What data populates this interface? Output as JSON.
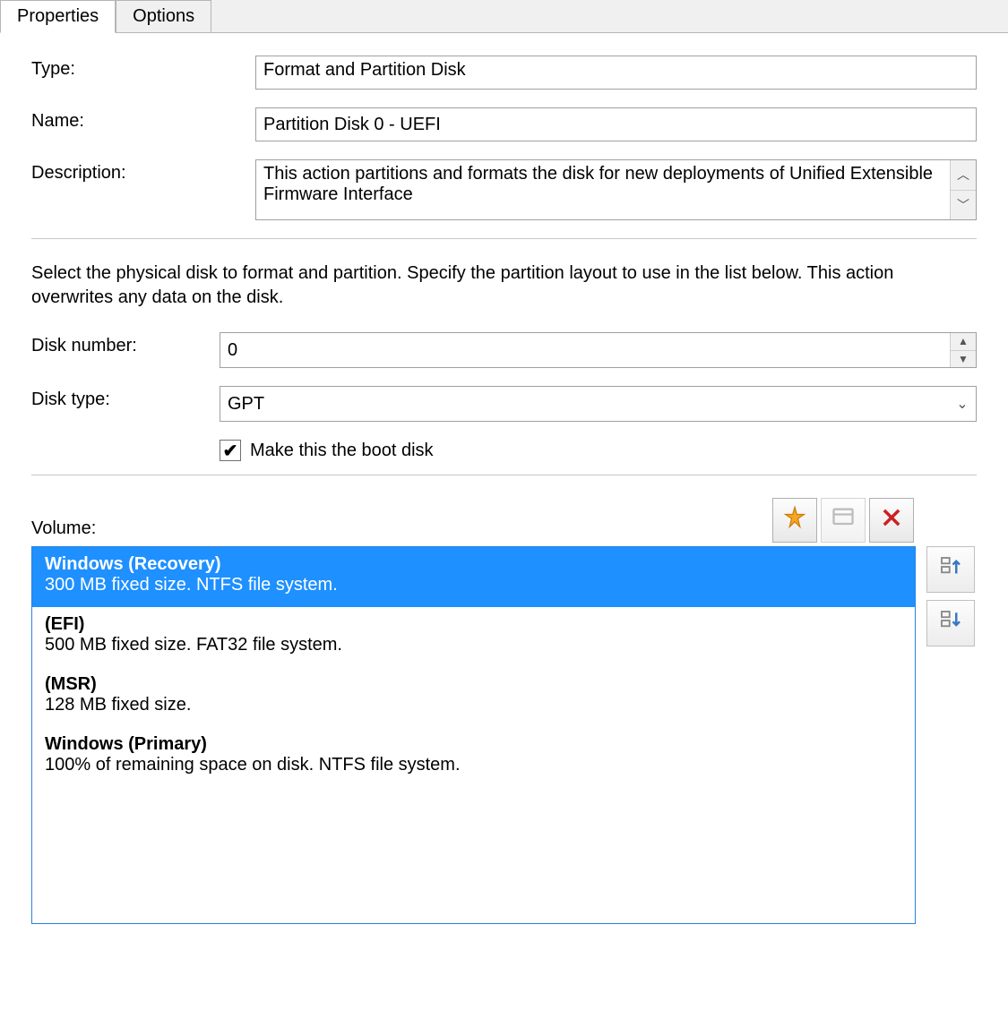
{
  "tabs": {
    "properties": "Properties",
    "options": "Options"
  },
  "labels": {
    "type": "Type:",
    "name": "Name:",
    "description": "Description:",
    "diskNumber": "Disk number:",
    "diskType": "Disk type:",
    "bootDisk": "Make this the boot disk",
    "volume": "Volume:"
  },
  "values": {
    "type": "Format and Partition Disk",
    "name": "Partition Disk 0 - UEFI",
    "description": "This action partitions and formats the disk for new deployments of Unified Extensible Firmware Interface",
    "diskNumber": "0",
    "diskType": "GPT",
    "bootDiskChecked": true
  },
  "instruction": "Select the physical disk to format and partition. Specify the partition layout to use in the list below. This action overwrites any data on the disk.",
  "volumes": [
    {
      "title": "Windows (Recovery)",
      "detail": "300 MB fixed size. NTFS file system.",
      "selected": true
    },
    {
      "title": "(EFI)",
      "detail": "500 MB fixed size. FAT32 file system.",
      "selected": false
    },
    {
      "title": "(MSR)",
      "detail": "128 MB fixed size.",
      "selected": false
    },
    {
      "title": "Windows (Primary)",
      "detail": "100% of remaining space on disk. NTFS file system.",
      "selected": false
    }
  ]
}
